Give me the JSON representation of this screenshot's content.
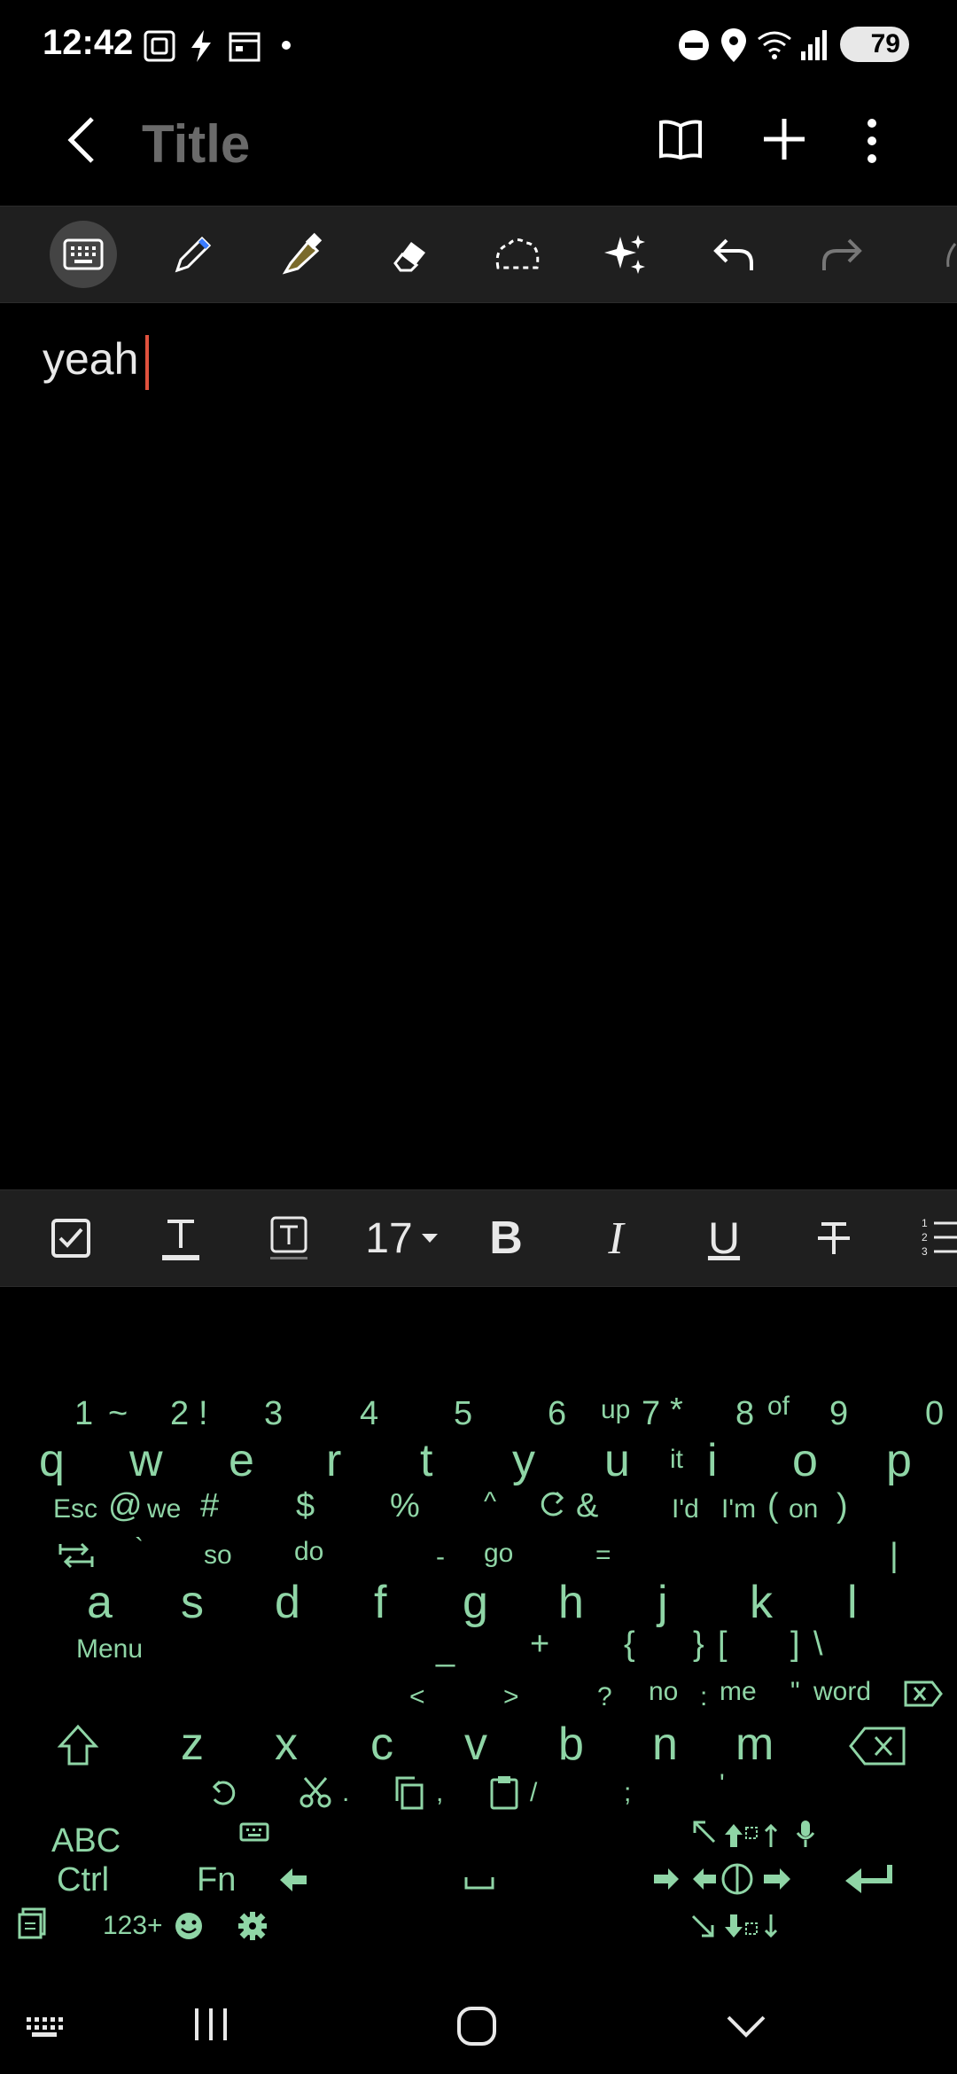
{
  "status": {
    "time": "12:42",
    "battery": "79"
  },
  "appbar": {
    "title": "Title"
  },
  "toolbar": {
    "tools": [
      "keyboard-icon",
      "pen-icon",
      "highlighter-icon",
      "eraser-icon",
      "lasso-icon",
      "sparkle-icon",
      "undo-icon",
      "redo-icon"
    ]
  },
  "editor": {
    "text": "yeah"
  },
  "format": {
    "font_size": "17",
    "bold": "B",
    "italic": "I",
    "underline": "U"
  },
  "keyboard": {
    "row1_top": [
      "1",
      "~",
      "2",
      "!",
      "3",
      "4",
      "5",
      "6",
      "up",
      "7",
      "*",
      "8",
      "of",
      "9",
      "0"
    ],
    "row1_main": [
      "q",
      "w",
      "e",
      "r",
      "t",
      "y",
      "u",
      "i",
      "o",
      "p"
    ],
    "row1_bottom": [
      "Esc",
      "@",
      "we",
      "#",
      "$",
      "%",
      "^",
      "&",
      "it",
      "I'd",
      "I'm",
      "(",
      "on",
      ")"
    ],
    "row2_top": [
      "`",
      "so",
      "do",
      "-",
      "go",
      "=",
      "|"
    ],
    "row2_main": [
      "a",
      "s",
      "d",
      "f",
      "g",
      "h",
      "j",
      "k",
      "l"
    ],
    "row2_bottom": [
      "Menu",
      "_",
      "+",
      "{",
      "}",
      "[",
      "]",
      "\\"
    ],
    "row3_top": [
      "<",
      ">",
      "?",
      "no",
      ":",
      "me",
      "\"",
      "word"
    ],
    "row3_main": [
      "z",
      "x",
      "c",
      "v",
      "b",
      "n",
      "m"
    ],
    "row3_bottom": [
      ".",
      ",",
      "/",
      ";",
      "'"
    ],
    "row4": {
      "abc": "ABC",
      "ctrl": "Ctrl",
      "fn": "Fn",
      "num": "123+"
    }
  },
  "colors": {
    "keyboard_text": "#8fd5a6",
    "cursor": "#e0523e",
    "toolbar_bg": "#1f1f1f"
  }
}
